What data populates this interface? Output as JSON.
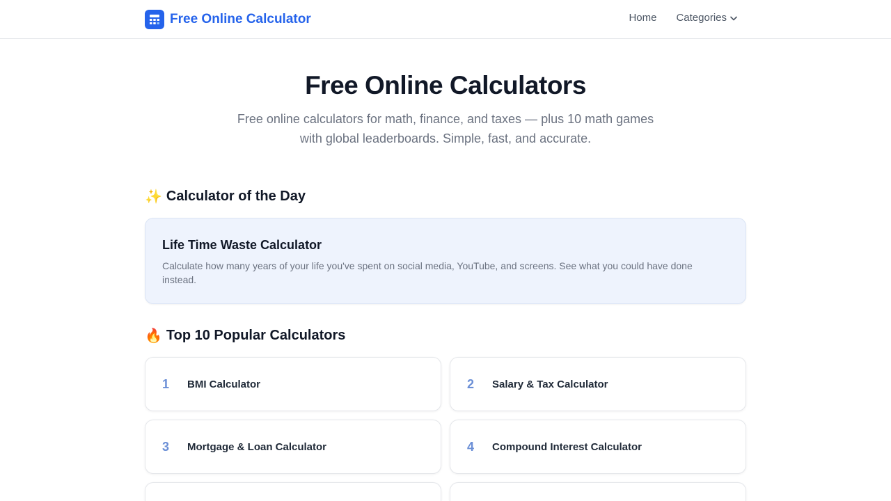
{
  "header": {
    "brand_name": "Free Online Calculator",
    "nav": [
      {
        "label": "Home"
      },
      {
        "label": "Categories"
      }
    ]
  },
  "hero": {
    "title": "Free Online Calculators",
    "subtitle": "Free online calculators for math, finance, and taxes — plus 10 math games with global leaderboards. Simple, fast, and accurate."
  },
  "calculator_of_the_day": {
    "heading_emoji": "✨",
    "heading": "Calculator of the Day",
    "name": "Life Time Waste Calculator",
    "description": "Calculate how many years of your life you've spent on social media, YouTube, and screens. See what you could have done instead."
  },
  "popular": {
    "heading_emoji": "🔥",
    "heading": "Top 10 Popular Calculators",
    "items": [
      {
        "rank": "1",
        "name": "BMI Calculator"
      },
      {
        "rank": "2",
        "name": "Salary & Tax Calculator"
      },
      {
        "rank": "3",
        "name": "Mortgage & Loan Calculator"
      },
      {
        "rank": "4",
        "name": "Compound Interest Calculator"
      },
      {
        "rank": "",
        "name": ""
      },
      {
        "rank": "",
        "name": ""
      }
    ]
  },
  "colors": {
    "brand": "#2563eb",
    "rank_number": "#6b8fd6",
    "featured_card_bg": "#eef3fd"
  },
  "icons": {
    "brand_logo": "calculator-icon",
    "categories_dropdown": "chevron-down-icon"
  }
}
